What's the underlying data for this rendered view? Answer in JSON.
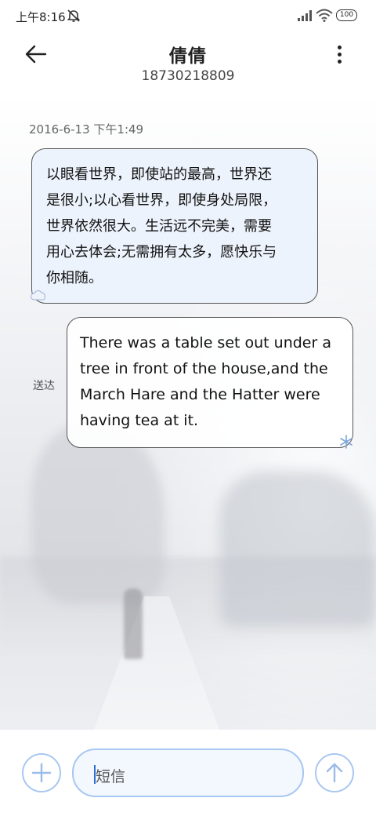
{
  "status_bar": {
    "time": "上午8:16",
    "battery_level": "100",
    "icons": [
      "mute-alarm-icon",
      "signal-icon",
      "wifi-icon",
      "battery-icon"
    ]
  },
  "header": {
    "back_icon": "back-arrow-icon",
    "contact_name": "倩倩",
    "phone_number": "18730218809",
    "more_icon": "more-vertical-icon"
  },
  "conversation": {
    "timestamp": "2016-6-13 下午1:49",
    "messages": [
      {
        "direction": "incoming",
        "lines": [
          "以眼看世界，即使站的最高，世界还",
          "是很小;以心看世界，即使身处局限，",
          "世界依然很大。生活远不完美，需要",
          "用心去体会;无需拥有太多，愿快乐与",
          "你相随。"
        ]
      },
      {
        "direction": "outgoing",
        "status": "送达",
        "lines": [
          "There was a table set out under a",
          "tree in front of the house,and the",
          "March Hare and the Hatter were",
          "having tea at it."
        ]
      }
    ]
  },
  "composer": {
    "add_icon": "plus-icon",
    "placeholder": "短信",
    "send_icon": "send-arrow-up-icon"
  },
  "colors": {
    "accent": "#a8c7f2",
    "caret": "#2a6fd6",
    "incoming_bubble": "#ecf2fc",
    "outgoing_bubble": "#ffffff",
    "bubble_border": "#555555"
  }
}
